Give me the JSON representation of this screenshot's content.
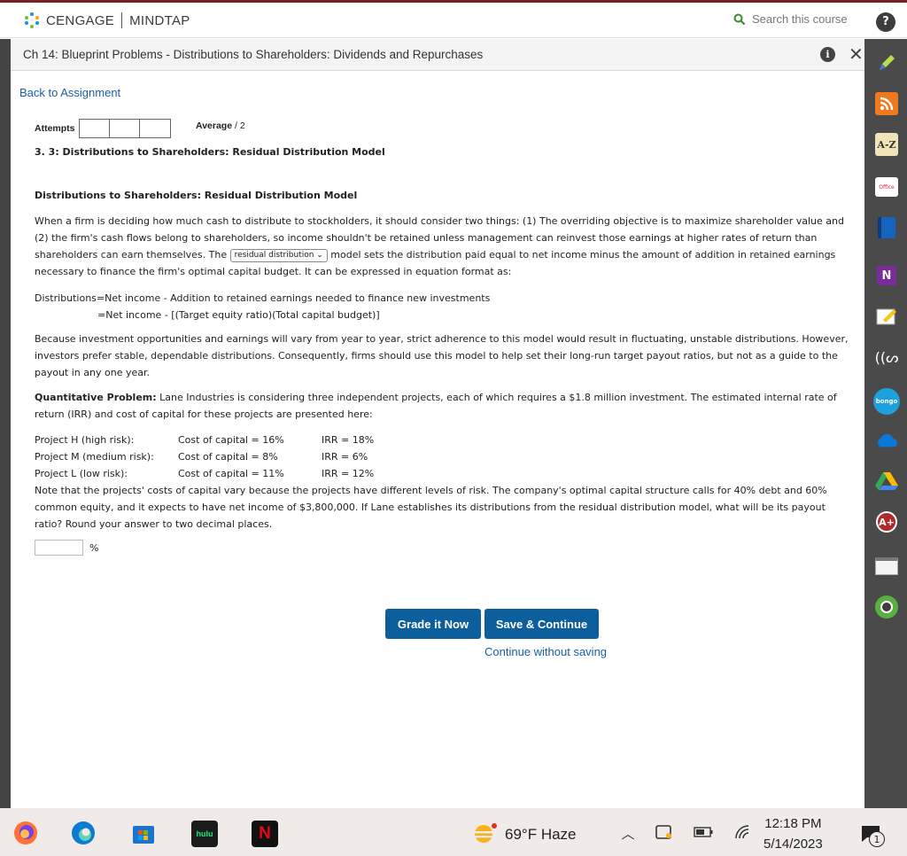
{
  "header": {
    "brand": "CENGAGE",
    "product": "MINDTAP",
    "search_placeholder": "Search this course",
    "help_label": "?"
  },
  "titlebar": {
    "title": "Ch 14: Blueprint Problems - Distributions to Shareholders: Dividends and Repurchases",
    "info_label": "i",
    "close_label": "✕"
  },
  "content": {
    "back_link": "Back to Assignment",
    "attempts_label": "Attempts",
    "average_label": "Average",
    "average_value": "/ 2",
    "question_number": "3.  3: Distributions to Shareholders: Residual Distribution Model",
    "section_title": "Distributions to Shareholders: Residual Distribution Model",
    "intro_part1": "When a firm is deciding how much cash to distribute to stockholders, it should consider two things: (1) The overriding objective is to maximize shareholder value and (2) the firm's cash flows belong to shareholders, so income shouldn't be retained unless management can reinvest those earnings at higher rates of return than shareholders can earn themselves. The ",
    "dropdown_value": "residual distribution",
    "intro_part2": " model sets the distribution paid equal to net income minus the amount of addition in retained earnings necessary to finance the firm's optimal capital budget. It can be expressed in equation format as:",
    "eq_line1": "Distributions=Net income - Addition to retained earnings needed to finance new investments",
    "eq_line2": "=Net income - [(Target equity ratio)(Total capital budget)]",
    "para2": "Because investment opportunities and earnings will vary from year to year, strict adherence to this model would result in fluctuating, unstable distributions. However, investors prefer stable, dependable distributions. Consequently, firms should use this model to help set their long-run target payout ratios, but not as a guide to the payout in any one year.",
    "qp_label": "Quantitative Problem:",
    "qp_text": " Lane Industries is considering three independent projects, each of which requires a $1.8 million investment. The estimated internal rate of return (IRR) and cost of capital for these projects are presented here:",
    "projects": [
      {
        "name": "Project H (high risk):",
        "coc": "Cost of capital = 16%",
        "irr": "IRR = 18%"
      },
      {
        "name": "Project M (medium risk):",
        "coc": "Cost of capital = 8%",
        "irr": "IRR = 6%"
      },
      {
        "name": "Project L (low risk):",
        "coc": "Cost of capital = 11%",
        "irr": "IRR = 12%"
      }
    ],
    "note": "Note that the projects' costs of capital vary because the projects have different levels of risk. The company's optimal capital structure calls for 40% debt and 60% common equity, and it expects to have net income of $3,800,000. If Lane establishes its distributions from the residual distribution model, what will be its payout ratio? Round your answer to two decimal places.",
    "answer_value": "",
    "answer_unit": "%",
    "grade_button": "Grade it Now",
    "save_button": "Save & Continue",
    "continue_link": "Continue without saving"
  },
  "sidebar_icons": [
    "pencil-icon",
    "rss-icon",
    "a-z-icon",
    "office-icon",
    "book-icon",
    "onenote-icon",
    "notes-icon",
    "speech-icon",
    "bongo-icon",
    "cloud-icon",
    "drive-icon",
    "aplus-icon",
    "flashcards-icon",
    "profile-icon"
  ],
  "taskbar": {
    "hulu_label": "hulu",
    "netflix_label": "N",
    "weather": "69°F  Haze",
    "time": "12:18 PM",
    "date": "5/14/2023",
    "notification_count": "1"
  },
  "colors": {
    "accent": "#0d5e9c",
    "link": "#1a5ea8",
    "top_line": "#7a1f22"
  }
}
